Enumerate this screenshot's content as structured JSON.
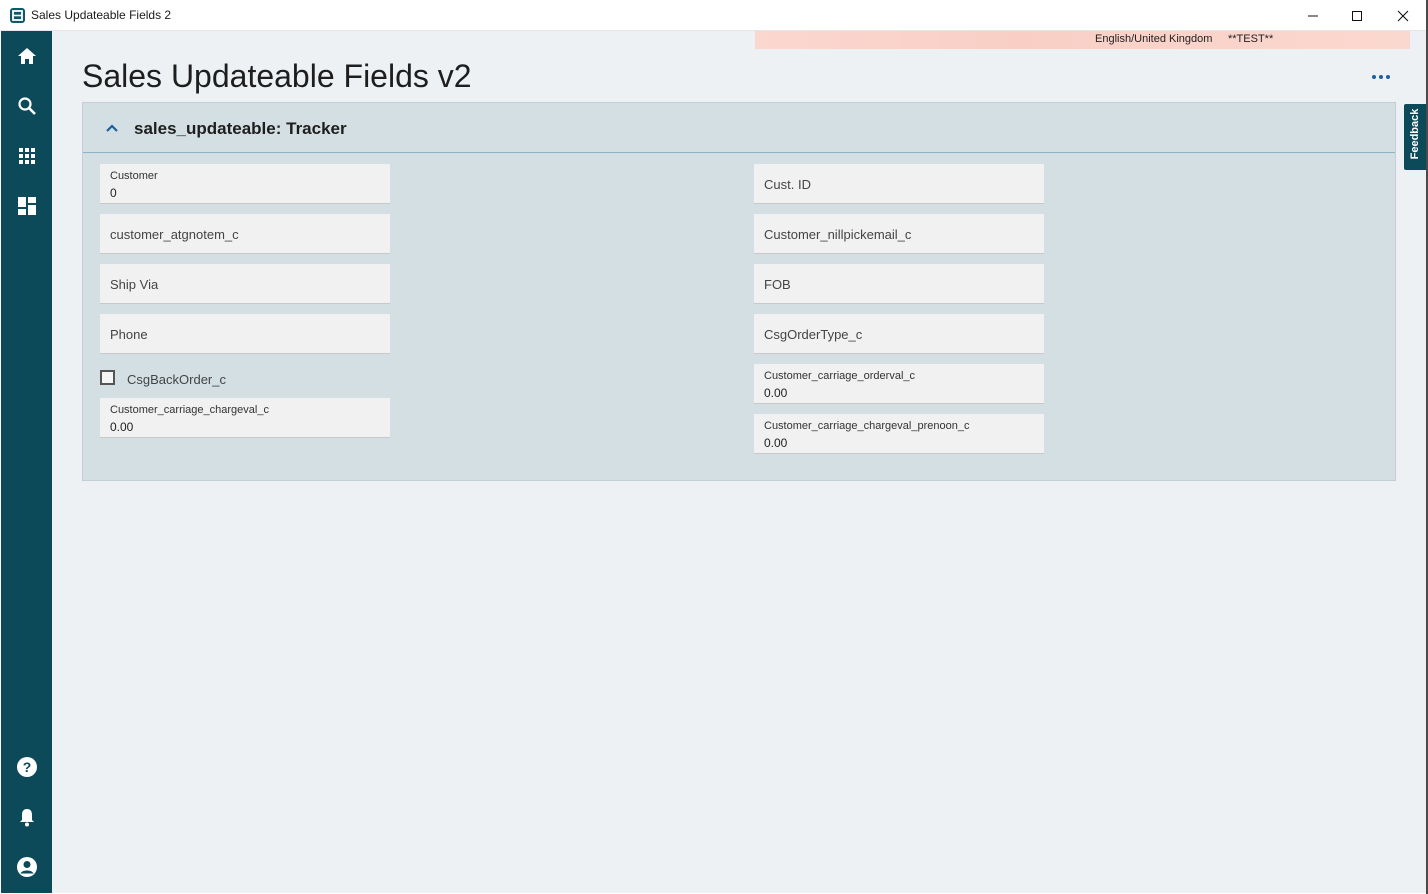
{
  "window": {
    "title": "Sales Updateable Fields 2",
    "controls": [
      "minimize",
      "maximize",
      "close"
    ]
  },
  "sidenav": {
    "top_icons": [
      "home-icon",
      "search-icon",
      "apps-grid-icon",
      "dashboard-icon"
    ],
    "bottom_icons": [
      "help-icon",
      "bell-icon",
      "account-icon"
    ]
  },
  "status_bar": {
    "language": "English/United Kingdom",
    "environment": "**TEST**"
  },
  "page": {
    "title": "Sales Updateable Fields v2",
    "more_label": "More actions"
  },
  "panel": {
    "title": "sales_updateable: Tracker",
    "collapse_icon": "chevron-up-icon"
  },
  "fields_left": [
    {
      "label": "Customer",
      "value": "0"
    },
    {
      "label": "customer_atgnotem_c",
      "value": ""
    },
    {
      "label": "Ship Via",
      "value": ""
    },
    {
      "label": "Phone",
      "value": ""
    }
  ],
  "checkbox": {
    "label": "CsgBackOrder_c",
    "checked": false
  },
  "field_left_last": {
    "label": "Customer_carriage_chargeval_c",
    "value": "0.00"
  },
  "fields_right": [
    {
      "label": "Cust. ID",
      "value": ""
    },
    {
      "label": "Customer_nillpickemail_c",
      "value": ""
    },
    {
      "label": "FOB",
      "value": ""
    },
    {
      "label": "CsgOrderType_c",
      "value": ""
    },
    {
      "label": "Customer_carriage_orderval_c",
      "value": "0.00"
    },
    {
      "label": "Customer_carriage_chargeval_prenoon_c",
      "value": "0.00"
    }
  ],
  "feedback": {
    "label": "Feedback"
  },
  "colors": {
    "nav": "#0c4a5a",
    "page_bg": "#edf1f4",
    "panel_bg": "#d3dfe3",
    "accent": "#1f5f9e"
  }
}
